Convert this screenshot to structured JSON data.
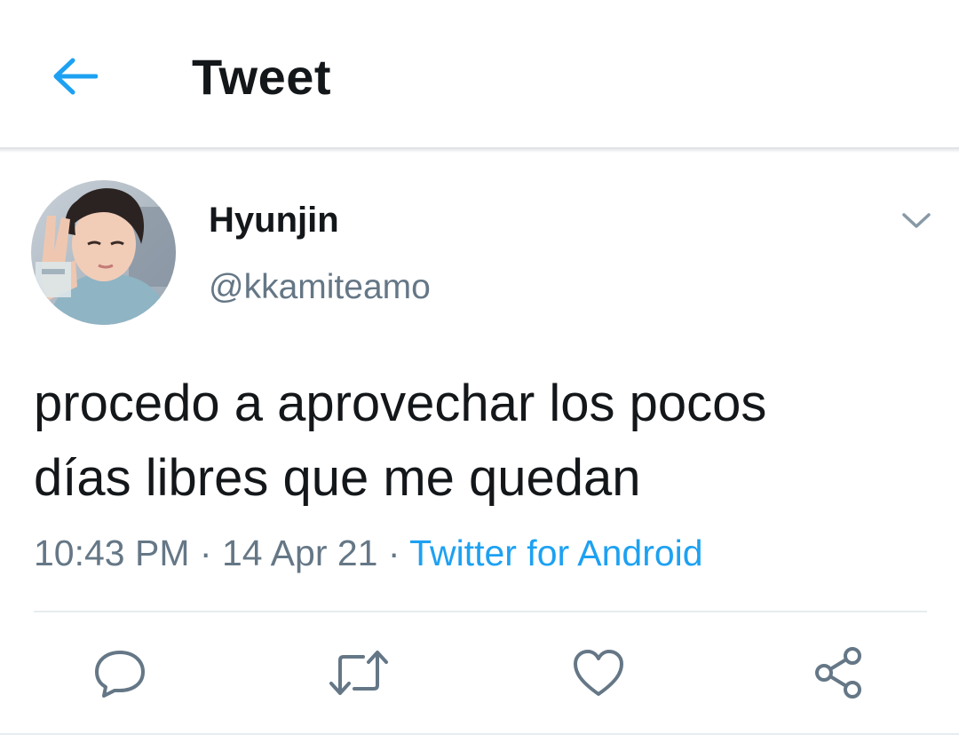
{
  "header": {
    "title": "Tweet",
    "back_icon": "arrow-left-icon"
  },
  "colors": {
    "accent": "#1da1f2",
    "text_primary": "#14171a",
    "text_secondary": "#657786",
    "divider": "#e6ecf0"
  },
  "tweet": {
    "author": {
      "display_name": "Hyunjin",
      "handle": "@kkamiteamo",
      "avatar_icon": "user-avatar"
    },
    "more_icon": "chevron-down-icon",
    "text_lines": [
      "procedo a aprovechar los pocos",
      "días libres que me quedan"
    ],
    "time": "10:43 PM",
    "separator": " · ",
    "date": "14 Apr 21",
    "source": "Twitter for Android"
  },
  "actions": [
    {
      "name": "reply",
      "icon": "reply-icon"
    },
    {
      "name": "retweet",
      "icon": "retweet-icon"
    },
    {
      "name": "like",
      "icon": "heart-icon"
    },
    {
      "name": "share",
      "icon": "share-icon"
    }
  ]
}
